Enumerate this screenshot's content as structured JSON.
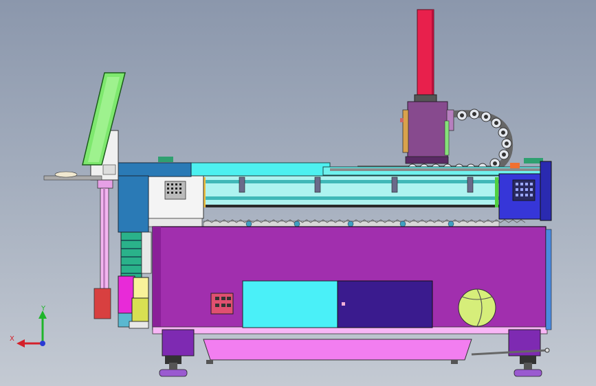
{
  "axes": {
    "x_label": "X",
    "y_label": "Y",
    "x_color": "#d4202a",
    "y_color": "#1fb52a",
    "z_color": "#2a3ad4"
  },
  "colors": {
    "background_top": "#8b97ac",
    "background_bottom": "#c4cad3",
    "machine_bed": "#a12fae",
    "gantry_column": "#e8204c",
    "cable_chain": "#d8dde6",
    "rail_cyan": "#4df0f0",
    "cabinet_blue": "#3a1b8e",
    "control_box_blue": "#2a5a9e",
    "monitor_green": "#7ee86e",
    "reel_yellow": "#d6ee7a",
    "tray_pink": "#f27ef0"
  }
}
